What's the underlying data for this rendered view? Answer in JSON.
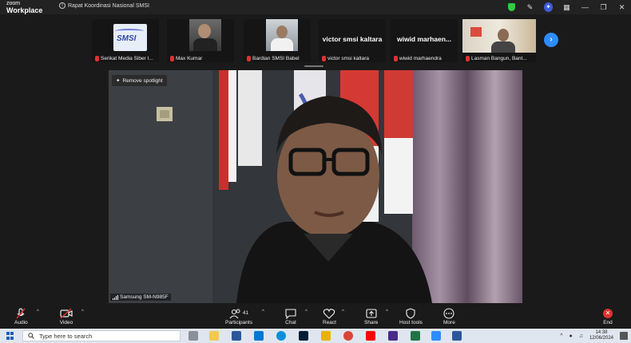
{
  "window": {
    "brand_top": "zoom",
    "brand_bottom": "Workplace",
    "meeting_title": "Rapat Koordinasi Nasional SMSI"
  },
  "thumbnails": [
    {
      "name": "Serikat Media Siber I...",
      "type": "logo",
      "logo_text": "SMSI",
      "muted": true
    },
    {
      "name": "Max Kumar",
      "type": "camera",
      "muted": true
    },
    {
      "name": "Bardian SMSI Babel",
      "type": "camera",
      "muted": true
    },
    {
      "name": "victor smsi kaltara",
      "type": "text",
      "big_name": "victor smsi kaltara",
      "muted": true
    },
    {
      "name": "wiwid marhaendra",
      "type": "text",
      "big_name": "wiwid marhaen...",
      "muted": true
    },
    {
      "name": "Lasman Bangun, Bant...",
      "type": "camera",
      "muted": true
    }
  ],
  "spotlight": {
    "remove_label": "Remove spotlight",
    "device_name": "Samsung SM-N985F"
  },
  "controls": {
    "audio": "Audio",
    "video": "Video",
    "participants": "Participants",
    "participants_count": "41",
    "chat": "Chat",
    "react": "React",
    "share": "Share",
    "host_tools": "Host tools",
    "more": "More",
    "end": "End"
  },
  "taskbar": {
    "search_placeholder": "Type here to search",
    "time": "14:38",
    "date": "12/06/2024"
  },
  "colors": {
    "accent": "#2d8cff",
    "danger": "#e03131",
    "secure": "#2ecc40",
    "background": "#1a1a1a"
  },
  "icons": [
    "info-icon",
    "shield-icon",
    "edit-icon",
    "ai-companion-icon",
    "apps-icon",
    "minimize-icon",
    "restore-icon",
    "close-icon",
    "mic-off-icon",
    "video-off-icon",
    "participants-icon",
    "chat-icon",
    "react-icon",
    "share-icon",
    "host-tools-icon",
    "more-icon",
    "end-icon",
    "search-icon",
    "windows-icon"
  ]
}
